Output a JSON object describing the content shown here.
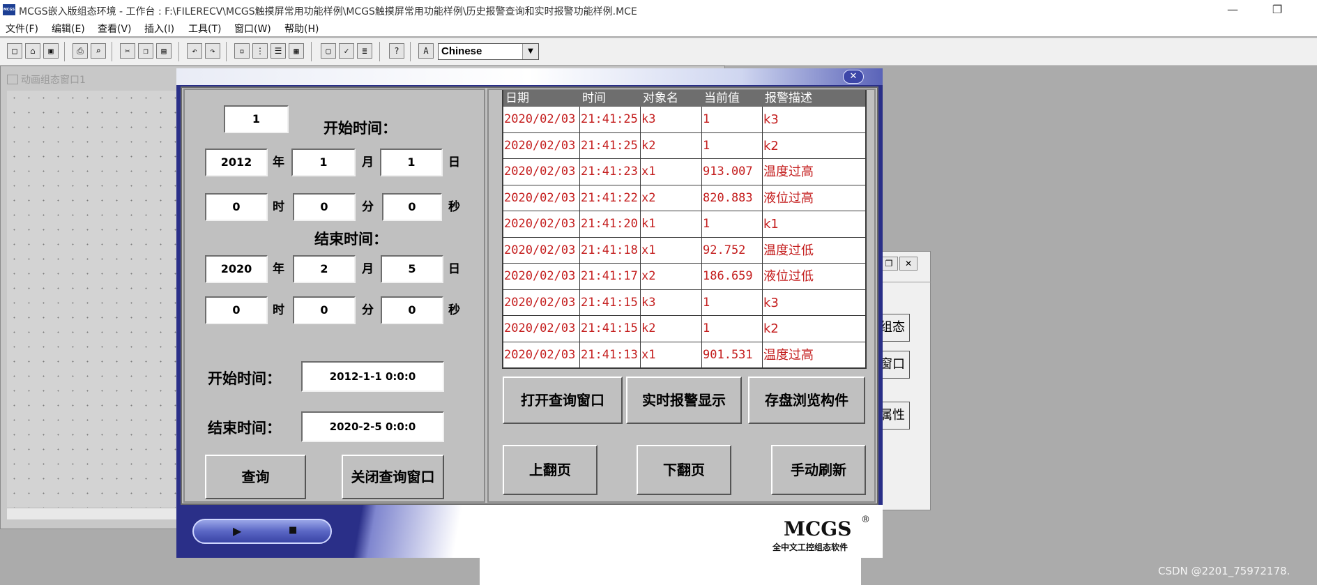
{
  "window": {
    "title": "MCGS嵌入版组态环境 - 工作台 : F:\\FILERECV\\MCGS触摸屏常用功能样例\\MCGS触摸屏常用功能样例\\历史报警查询和实时报警功能样例.MCE",
    "app_icon": "MCGS",
    "minimize": "—",
    "restore": "❐"
  },
  "menu": [
    {
      "label": "文件(F)"
    },
    {
      "label": "编辑(E)"
    },
    {
      "label": "查看(V)"
    },
    {
      "label": "插入(I)"
    },
    {
      "label": "工具(T)"
    },
    {
      "label": "窗口(W)"
    },
    {
      "label": "帮助(H)"
    }
  ],
  "toolbar": {
    "icons": [
      "new-file-icon",
      "open-folder-icon",
      "save-icon",
      "print-icon",
      "print-preview-icon",
      "cut-icon",
      "copy-icon",
      "paste-icon",
      "undo-icon",
      "redo-icon",
      "align-icon",
      "tree-icon",
      "list-icon",
      "grid-icon",
      "properties-icon",
      "check-icon",
      "compile-icon",
      "help-icon",
      "font-icon"
    ],
    "language": "Chinese"
  },
  "design_window": {
    "title": "动画组态窗口1"
  },
  "side_window": {
    "buttons": [
      "组态",
      "窗口",
      "属性"
    ],
    "close": "✕",
    "restore": "❐"
  },
  "dialog": {
    "close": "✕",
    "page_no": "1",
    "start_label": "开始时间：",
    "end_label": "结束时间：",
    "start": {
      "year": "2012",
      "month": "1",
      "day": "1",
      "hour": "0",
      "minute": "0",
      "second": "0"
    },
    "end": {
      "year": "2020",
      "month": "2",
      "day": "5",
      "hour": "0",
      "minute": "0",
      "second": "0"
    },
    "units": {
      "year": "年",
      "month": "月",
      "day": "日",
      "hour": "时",
      "minute": "分",
      "second": "秒"
    },
    "start_summary_label": "开始时间：",
    "start_summary_value": "2012-1-1 0:0:0",
    "end_summary_label": "结束时间：",
    "end_summary_value": "2020-2-5 0:0:0",
    "query_button": "查询",
    "close_query_button": "关闭查询窗口"
  },
  "alarm_table": {
    "headers": [
      "日期",
      "时间",
      "对象名",
      "当前值",
      "报警描述"
    ],
    "rows": [
      [
        "2020/02/03",
        "21:41:25",
        "k3",
        "1",
        "k3"
      ],
      [
        "2020/02/03",
        "21:41:25",
        "k2",
        "1",
        "k2"
      ],
      [
        "2020/02/03",
        "21:41:23",
        "x1",
        "913.007",
        "温度过高"
      ],
      [
        "2020/02/03",
        "21:41:22",
        "x2",
        "820.883",
        "液位过高"
      ],
      [
        "2020/02/03",
        "21:41:20",
        "k1",
        "1",
        "k1"
      ],
      [
        "2020/02/03",
        "21:41:18",
        "x1",
        "92.752",
        "温度过低"
      ],
      [
        "2020/02/03",
        "21:41:17",
        "x2",
        "186.659",
        "液位过低"
      ],
      [
        "2020/02/03",
        "21:41:15",
        "k3",
        "1",
        "k3"
      ],
      [
        "2020/02/03",
        "21:41:15",
        "k2",
        "1",
        "k2"
      ],
      [
        "2020/02/03",
        "21:41:13",
        "x1",
        "901.531",
        "温度过高"
      ]
    ],
    "text_color": "#c41d1d"
  },
  "right_buttons": {
    "open_query": "打开查询窗口",
    "realtime_alarm": "实时报警显示",
    "storage_browse": "存盘浏览构件",
    "page_up": "上翻页",
    "page_down": "下翻页",
    "manual_refresh": "手动刷新"
  },
  "player": {
    "play": "▶",
    "stop": "■"
  },
  "logo": {
    "name": "MCGS",
    "reg": "®",
    "subtitle": "全中文工控组态软件"
  },
  "watermark": "CSDN @2201_75972178."
}
